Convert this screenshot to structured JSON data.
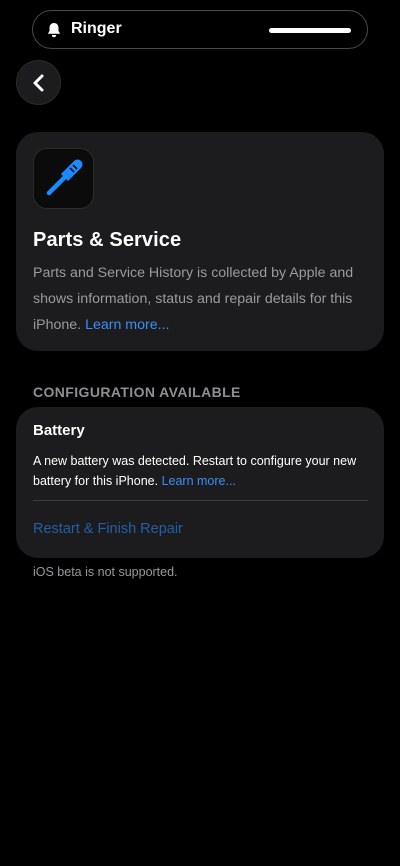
{
  "ringer": {
    "label": "Ringer",
    "icon": "bell-icon"
  },
  "back": {
    "icon": "chevron-left-icon"
  },
  "parts_card": {
    "icon": "screwdriver-icon",
    "title": "Parts & Service",
    "description": "Parts and Service History is collected by Apple and shows information, status and repair details for this iPhone.",
    "learn_more": "Learn more..."
  },
  "section": {
    "header": "CONFIGURATION AVAILABLE"
  },
  "battery_card": {
    "title": "Battery",
    "description": "A new battery was detected. Restart to configure your new battery for this iPhone.",
    "learn_more": "Learn more...",
    "action_label": "Restart & Finish Repair"
  },
  "footer": {
    "note": "iOS beta is not supported."
  },
  "colors": {
    "background": "#000000",
    "card": "#1c1c1e",
    "link": "#3b8ef6",
    "action": "#235fa8",
    "secondary_text": "#9a9a9f"
  }
}
